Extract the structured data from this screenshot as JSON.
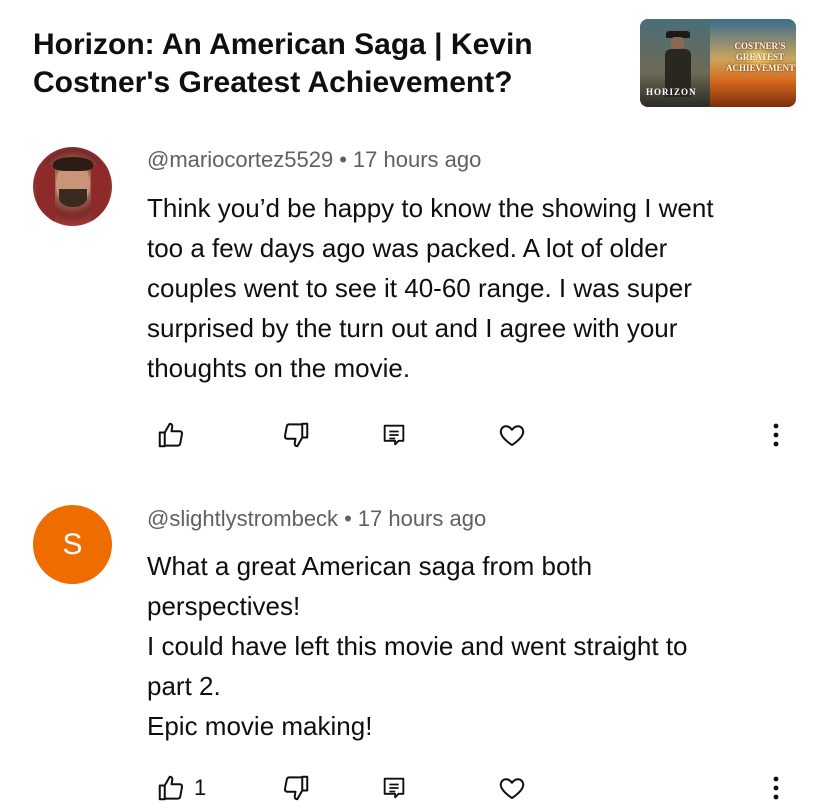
{
  "video": {
    "title": "Horizon: An American Saga | Kevin Costner's Greatest Achievement?",
    "thumbnail": {
      "left_text": "HORIZON",
      "right_text": "COSTNER'S GREATEST ACHIEVEMENT?"
    }
  },
  "comments": [
    {
      "author": "@mariocortez5529",
      "separator": "•",
      "time": "17 hours ago",
      "avatar_type": "photo",
      "lines": [
        "Think you’d be happy to know the showing I went",
        "too a few days ago was packed. A lot of older",
        "couples went to see it 40-60 range. I was super",
        "surprised by the turn out and I agree with your",
        "thoughts on the movie."
      ],
      "like_count": "",
      "icons": [
        "thumbs-up-icon",
        "thumbs-down-icon",
        "reply-icon",
        "heart-icon",
        "more-vertical-icon"
      ]
    },
    {
      "author": "@slightlystrombeck",
      "separator": "•",
      "time": "17 hours ago",
      "avatar_type": "letter",
      "avatar_letter": "S",
      "avatar_color": "#ef6c00",
      "lines": [
        "What a great American saga from both",
        "perspectives!",
        "I could have left this movie and went straight to",
        "part 2.",
        "Epic movie making!"
      ],
      "like_count": "1",
      "icons": [
        "thumbs-up-icon",
        "thumbs-down-icon",
        "reply-icon",
        "heart-icon",
        "more-vertical-icon"
      ]
    }
  ]
}
